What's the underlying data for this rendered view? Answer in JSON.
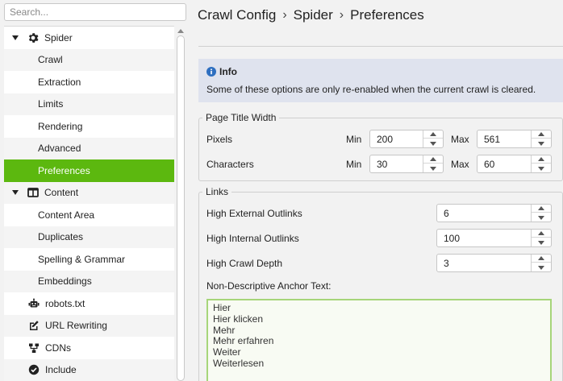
{
  "search": {
    "placeholder": "Search..."
  },
  "tree": [
    {
      "kind": "parent",
      "label": "Spider",
      "icon": "gear-icon",
      "name": "tree-item-spider"
    },
    {
      "kind": "child",
      "label": "Crawl",
      "name": "tree-item-crawl"
    },
    {
      "kind": "child",
      "label": "Extraction",
      "name": "tree-item-extraction"
    },
    {
      "kind": "child",
      "label": "Limits",
      "name": "tree-item-limits"
    },
    {
      "kind": "child",
      "label": "Rendering",
      "name": "tree-item-rendering"
    },
    {
      "kind": "child",
      "label": "Advanced",
      "name": "tree-item-advanced"
    },
    {
      "kind": "child",
      "label": "Preferences",
      "name": "tree-item-preferences",
      "selected": true
    },
    {
      "kind": "parent",
      "label": "Content",
      "icon": "columns-icon",
      "name": "tree-item-content"
    },
    {
      "kind": "child",
      "label": "Content Area",
      "name": "tree-item-content-area"
    },
    {
      "kind": "child",
      "label": "Duplicates",
      "name": "tree-item-duplicates"
    },
    {
      "kind": "child",
      "label": "Spelling & Grammar",
      "name": "tree-item-spelling-grammar"
    },
    {
      "kind": "child",
      "label": "Embeddings",
      "name": "tree-item-embeddings"
    },
    {
      "kind": "leaf",
      "label": "robots.txt",
      "icon": "robot-icon",
      "name": "tree-item-robots-txt"
    },
    {
      "kind": "leaf",
      "label": "URL Rewriting",
      "icon": "edit-icon",
      "name": "tree-item-url-rewriting"
    },
    {
      "kind": "leaf",
      "label": "CDNs",
      "icon": "network-icon",
      "name": "tree-item-cdns"
    },
    {
      "kind": "leaf",
      "label": "Include",
      "icon": "check-circle-icon",
      "name": "tree-item-include"
    }
  ],
  "breadcrumb": {
    "part1": "Crawl Config",
    "part2": "Spider",
    "part3": "Preferences",
    "separator": "›"
  },
  "info": {
    "title": "Info",
    "text": "Some of these options are only re-enabled when the current crawl is cleared."
  },
  "page_title_width": {
    "legend": "Page Title Width",
    "pixels_label": "Pixels",
    "characters_label": "Characters",
    "min_label": "Min",
    "max_label": "Max",
    "pixels_min": "200",
    "pixels_max": "561",
    "characters_min": "30",
    "characters_max": "60"
  },
  "links": {
    "legend": "Links",
    "high_external_label": "High External Outlinks",
    "high_external_value": "6",
    "high_internal_label": "High Internal Outlinks",
    "high_internal_value": "100",
    "high_depth_label": "High Crawl Depth",
    "high_depth_value": "3",
    "anchor_label": "Non-Descriptive Anchor Text:",
    "anchor_text": "Hier\nHier klicken\nMehr\nMehr erfahren\nWeiter\nWeiterlesen"
  },
  "colors": {
    "selected": "#5cb80f",
    "info_bg": "#dfe3ee",
    "info_icon": "#2e6fc0"
  }
}
